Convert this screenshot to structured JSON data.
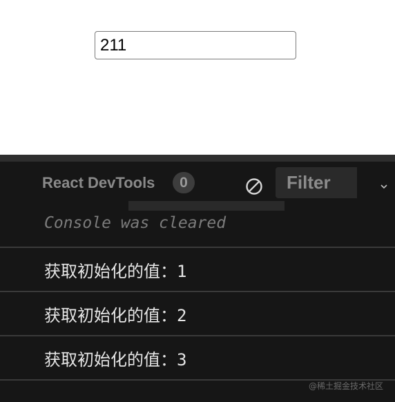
{
  "page": {
    "input_value": "211"
  },
  "devtools": {
    "label": "React DevTools",
    "badge_count": "0",
    "filter_label": "Filter",
    "dropdown_glyph": "⌄",
    "cleared_message": "Console was cleared",
    "logs": [
      {
        "text": "获取初始化的值：",
        "value": "1"
      },
      {
        "text": "获取初始化的值：",
        "value": "2"
      },
      {
        "text": "获取初始化的值：",
        "value": "3"
      }
    ],
    "watermark": "@稀土掘金技术社区"
  },
  "colors": {
    "console_background": "#161616",
    "toolbar_muted_text": "#8a8a8a",
    "log_text": "#e6e6e6",
    "divider": "#3a3a3a"
  },
  "icons": {
    "clear": "clear-console-icon",
    "dropdown": "chevron-down-icon"
  }
}
